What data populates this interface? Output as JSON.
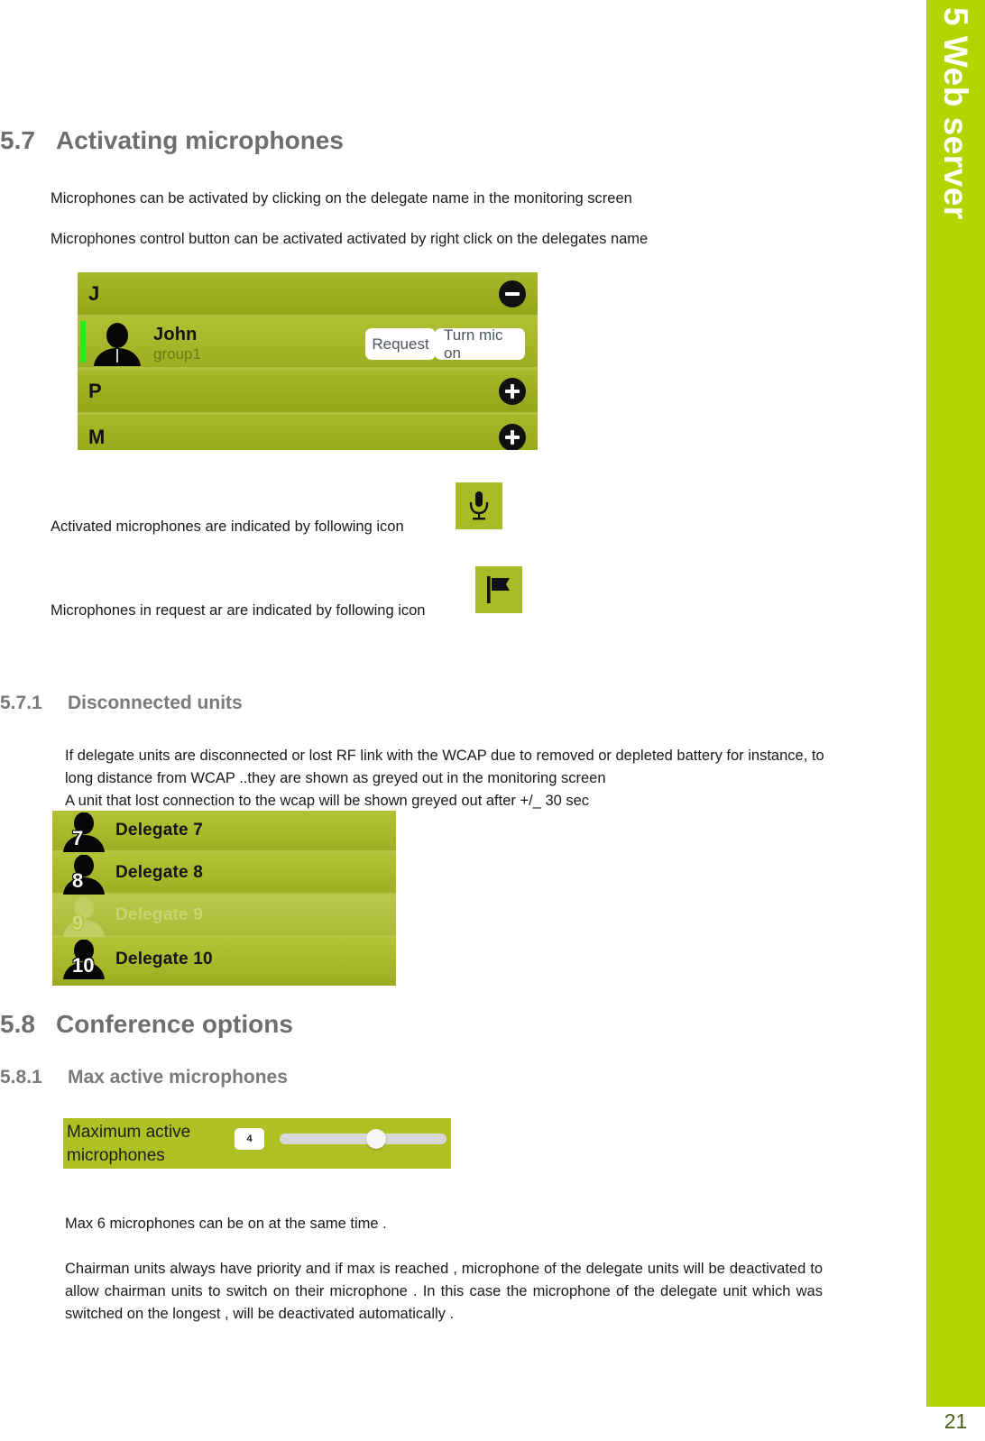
{
  "sidebar": {
    "chapter_label": "5  Web server",
    "accent_color": "#b4d400"
  },
  "page_number": "21",
  "sections": {
    "s57": {
      "number": "5.7",
      "title": "Activating microphones",
      "para1": "Microphones can be activated by clicking on the delegate name in the monitoring screen",
      "para2": "Microphones control button can be activated activated by right click on the delegates name",
      "activated_icon_text": "Activated microphones are indicated by following icon",
      "request_icon_text": "Microphones in request ar are indicated by following icon"
    },
    "s571": {
      "number": "5.7.1",
      "title": "Disconnected units",
      "para1": "If delegate units are disconnected or lost RF link with the WCAP due to removed or depleted battery for instance, to long distance from WCAP ..they are shown as greyed out in the monitoring screen",
      "para2": "A unit that lost connection to the wcap will be shown greyed out after +/_ 30 sec"
    },
    "s58": {
      "number": "5.8",
      "title": "Conference options"
    },
    "s581": {
      "number": "5.8.1",
      "title": "Max active microphones",
      "para1": "Max 6 microphones can be on at the same time .",
      "para2": "Chairman units always have priority and if max is reached , microphone of the delegate units will be deactivated to allow chairman units to switch on their microphone . In this case the microphone of the delegate unit which was switched on the longest , will be deactivated automatically ."
    }
  },
  "monitor_widget": {
    "group_rows": [
      {
        "letter": "J",
        "toggle": "minus-circle-icon"
      },
      {
        "letter": "P",
        "toggle": "plus-circle-icon"
      },
      {
        "letter": "M",
        "toggle": "plus-circle-icon"
      }
    ],
    "delegate": {
      "name": "John",
      "group": "group1",
      "request_button": "Request",
      "mic_button": "Turn mic on",
      "active_indicator_color": "#22ef22"
    }
  },
  "icon_badges": {
    "mic": "microphone-icon",
    "flag": "flag-icon",
    "background_color": "#a9bb25"
  },
  "disconnected_widget": {
    "rows": [
      {
        "num": "7",
        "name": "Delegate 7",
        "state": "connected"
      },
      {
        "num": "8",
        "name": "Delegate 8",
        "state": "connected"
      },
      {
        "num": "9",
        "name": "Delegate 9",
        "state": "disconnected"
      },
      {
        "num": "10",
        "name": "Delegate 10",
        "state": "connected"
      }
    ]
  },
  "slider_widget": {
    "label": "Maximum active microphones",
    "value": "4",
    "thumb_percent": 58
  }
}
